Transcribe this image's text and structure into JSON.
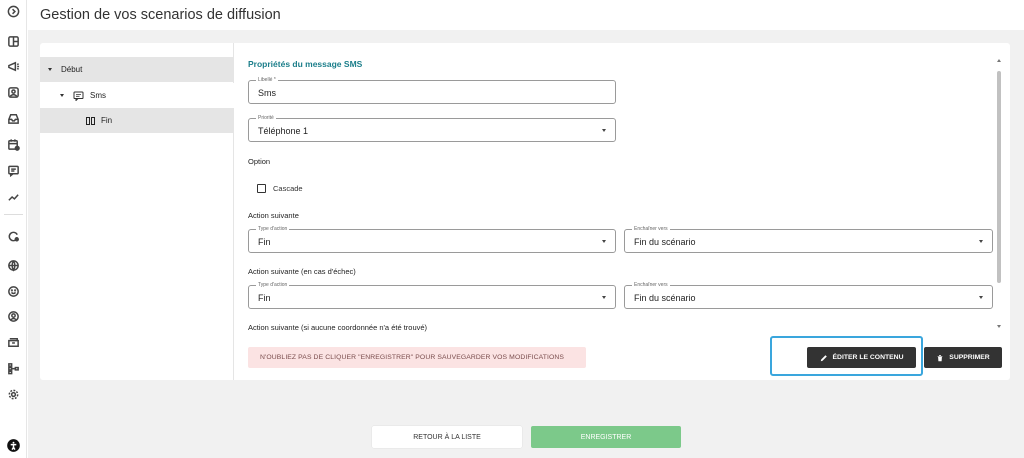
{
  "page": {
    "title": "Gestion de vos scenarios de diffusion"
  },
  "rail": {
    "icons": [
      "chevron-right-circle-icon",
      "layout-icon",
      "megaphone-icon",
      "image-icon",
      "inbox-icon",
      "calendar-settings-icon",
      "chat-icon",
      "chart-line-icon",
      "refresh-settings-icon",
      "globe-icon",
      "smiley-icon",
      "user-circle-icon",
      "archive-icon",
      "sitemap-icon",
      "gear-icon",
      "accessibility-icon"
    ]
  },
  "tree": {
    "items": [
      {
        "label": "Début",
        "level": 0,
        "expanded": true
      },
      {
        "label": "Sms",
        "level": 1,
        "expanded": true,
        "icon": "message-icon"
      },
      {
        "label": "Fin",
        "level": 2,
        "selected": true,
        "icon": "end-icon"
      }
    ]
  },
  "props": {
    "title": "Propriétés du message SMS",
    "libelle": {
      "label": "Libellé *",
      "value": "Sms"
    },
    "priorite": {
      "label": "Priorité",
      "value": "Téléphone 1"
    },
    "option_label": "Option",
    "cascade": {
      "label": "Cascade",
      "checked": false
    },
    "action_suivante": {
      "heading": "Action suivante",
      "type": {
        "label": "Type d'action",
        "value": "Fin"
      },
      "enchainer": {
        "label": "Enchaîner vers",
        "value": "Fin du scénario"
      }
    },
    "action_echec": {
      "heading": "Action suivante (en cas d'échec)",
      "type": {
        "label": "Type d'action",
        "value": "Fin"
      },
      "enchainer": {
        "label": "Enchaîner vers",
        "value": "Fin du scénario"
      }
    },
    "action_aucune": {
      "heading": "Action suivante (si aucune coordonnée n'a été trouvé)"
    }
  },
  "footer_card": {
    "warning": "N'OUBLIEZ PAS DE CLIQUER \"ENREGISTRER\" POUR SAUVEGARDER VOS MODIFICATIONS",
    "edit_label": "ÉDITER LE CONTENU",
    "delete_label": "SUPPRIMER"
  },
  "actions": {
    "back_label": "RETOUR À LA LISTE",
    "save_label": "ENREGISTRER"
  },
  "colors": {
    "accent": "#1b7e8a",
    "save": "#7cc98a",
    "highlight": "#3aa6dd",
    "dark_button": "#333333"
  }
}
